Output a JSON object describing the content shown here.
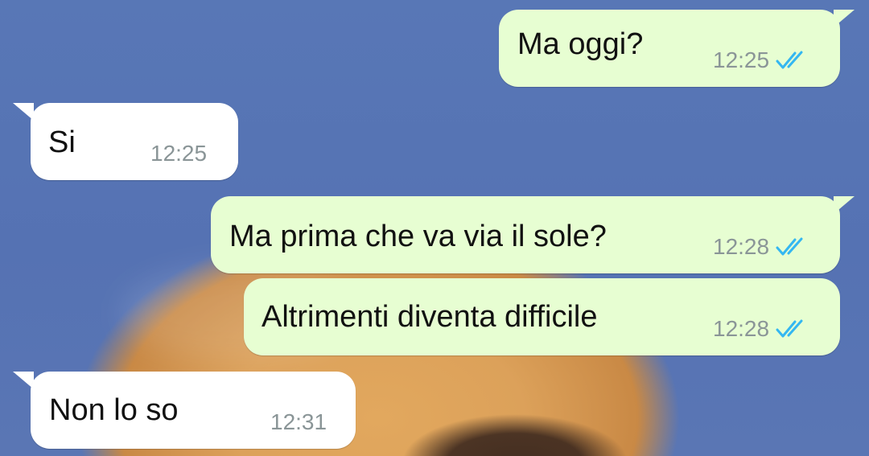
{
  "messages": [
    {
      "direction": "outgoing",
      "text": "Ma oggi?",
      "time": "12:25",
      "status": "read-double-check-icon"
    },
    {
      "direction": "incoming",
      "text": "Si",
      "time": "12:25"
    },
    {
      "direction": "outgoing",
      "text": "Ma prima che va via il sole?",
      "time": "12:28",
      "status": "read-double-check-icon"
    },
    {
      "direction": "outgoing",
      "text": "Altrimenti diventa difficile",
      "time": "12:28",
      "status": "read-double-check-icon"
    },
    {
      "direction": "incoming",
      "text": "Non lo so",
      "time": "12:31"
    }
  ],
  "colors": {
    "outgoing_bubble": "#e7fed2",
    "incoming_bubble": "#ffffff",
    "read_check": "#34b7f1",
    "time_text": "#8a9597",
    "wallpaper_sky": "#5673b3"
  }
}
